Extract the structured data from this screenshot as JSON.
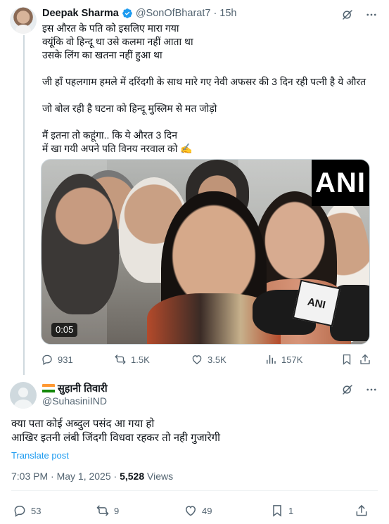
{
  "parent_tweet": {
    "author_name": "Deepak Sharma",
    "handle": "@SonOfBharat7",
    "separator": "·",
    "time": "15h",
    "lines": [
      "इस औरत के पति को इसलिए मारा गया",
      "क्यूंकि वो हिन्दू था उसे कलमा नहीं आता था",
      "उसके लिंग का खतना नहीं हुआ था",
      "",
      "जी हाँ पहलगाम हमले में दरिंदगी के साथ मारे गए नेवी अफसर की 3 दिन रही पत्नी है ये औरत",
      "",
      "जो बोल रही है घटना को हिन्दू मुस्लिम से मत जोड़ो",
      "",
      "मैं इतना तो कहूंगा.. कि ये औरत 3 दिन",
      "में खा गयी अपने पति विनय नरवाल को ✍️"
    ],
    "video": {
      "watermark": "ANI",
      "mic_label": "ANI",
      "duration": "0:05"
    },
    "stats": {
      "replies": "931",
      "reposts": "1.5K",
      "likes": "3.5K",
      "views": "157K"
    }
  },
  "reply_tweet": {
    "author_name": "सुहानी तिवारी",
    "handle": "@SuhasiniIND",
    "lines": [
      "क्या पता कोई अब्दुल पसंद आ गया हो",
      "आखिर इतनी लंबी जिंदगी विधवा रहकर तो नही गुजारेगी"
    ],
    "translate_label": "Translate post",
    "timestamp": "7:03 PM · May 1, 2025 · ",
    "views_count": "5,528",
    "views_label": " Views",
    "stats": {
      "replies": "53",
      "reposts": "9",
      "likes": "49",
      "bookmarks": "1"
    }
  },
  "colors": {
    "accent": "#1d9bf0",
    "secondary_text": "#536471",
    "primary_text": "#0f1419",
    "flag_saffron": "#ff9933",
    "flag_white": "#ffffff",
    "flag_green": "#138808"
  },
  "icons": [
    "verified-badge-icon",
    "grok-icon",
    "more-icon",
    "reply-icon",
    "repost-icon",
    "like-icon",
    "views-icon",
    "bookmark-icon",
    "share-icon",
    "india-flag-icon"
  ]
}
